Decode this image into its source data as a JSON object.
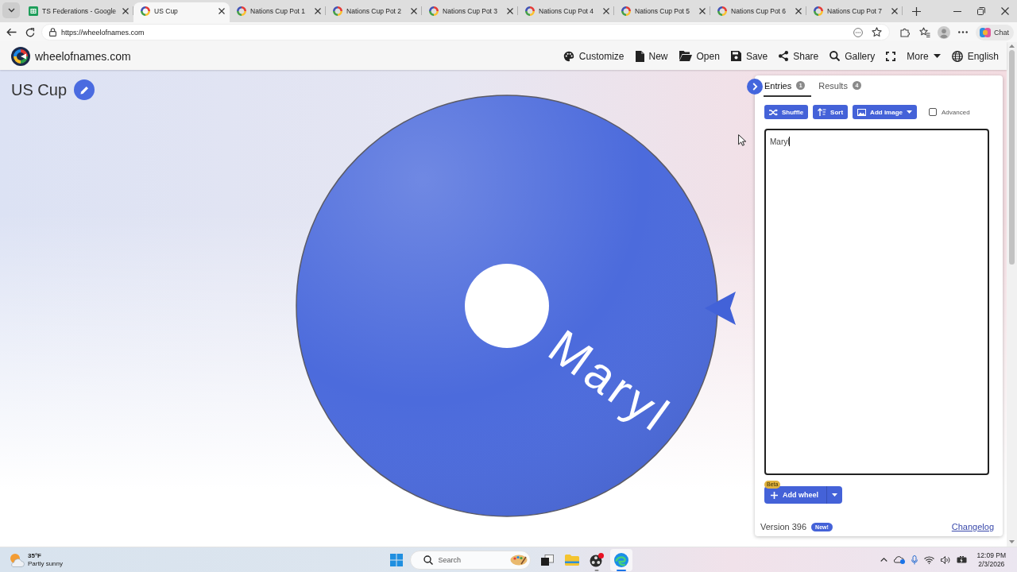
{
  "browser": {
    "tabs": [
      {
        "title": "TS Federations - Google",
        "kind": "sheets",
        "selected": false
      },
      {
        "title": "US Cup",
        "kind": "wheel",
        "selected": true
      },
      {
        "title": "Nations Cup Pot 1",
        "kind": "wheel",
        "selected": false
      },
      {
        "title": "Nations Cup Pot 2",
        "kind": "wheel",
        "selected": false
      },
      {
        "title": "Nations Cup Pot 3",
        "kind": "wheel",
        "selected": false
      },
      {
        "title": "Nations Cup Pot 4",
        "kind": "wheel",
        "selected": false
      },
      {
        "title": "Nations Cup Pot 5",
        "kind": "wheel",
        "selected": false
      },
      {
        "title": "Nations Cup Pot 6",
        "kind": "wheel",
        "selected": false
      },
      {
        "title": "Nations Cup Pot 7",
        "kind": "wheel",
        "selected": false
      }
    ],
    "url": "https://wheelofnames.com",
    "chat": "Chat"
  },
  "site": {
    "name": "wheelofnames.com",
    "nav": [
      {
        "kind": "customize",
        "label": "Customize"
      },
      {
        "kind": "new",
        "label": "New"
      },
      {
        "kind": "open",
        "label": "Open"
      },
      {
        "kind": "save",
        "label": "Save"
      },
      {
        "kind": "share",
        "label": "Share"
      },
      {
        "kind": "gallery",
        "label": "Gallery"
      },
      {
        "kind": "fullscreen"
      },
      {
        "kind": "more",
        "label": "More"
      },
      {
        "kind": "language",
        "label": "English"
      }
    ]
  },
  "wheel": {
    "title": "US Cup",
    "slices": [
      {
        "label": "Maryl"
      }
    ]
  },
  "panel": {
    "tabs": [
      {
        "label": "Entries",
        "count": "1",
        "selected": true
      },
      {
        "label": "Results",
        "count": "4",
        "selected": false
      }
    ],
    "tools": [
      {
        "kind": "shuffle",
        "label": "Shuffle"
      },
      {
        "kind": "sort",
        "label": "Sort"
      },
      {
        "kind": "add_image",
        "label": "Add image"
      }
    ],
    "advanced": {
      "label": "Advanced",
      "checked": false
    },
    "entries": [
      "Maryl"
    ],
    "add_wheel": {
      "label": "Add wheel",
      "badge": "Beta"
    },
    "version": "Version 396",
    "version_badge": "New!",
    "changelog": "Changelog"
  },
  "taskbar": {
    "weather": {
      "temperature": "35°F",
      "condition": "Partly sunny"
    },
    "search_placeholder": "Search",
    "apps": [
      {
        "kind": "task_view",
        "selected": false,
        "running": false
      },
      {
        "kind": "file_explorer",
        "selected": false,
        "running": false
      },
      {
        "kind": "recorder",
        "selected": false,
        "running": true
      },
      {
        "kind": "browser",
        "selected": true,
        "running": true
      }
    ],
    "time": "12:09 PM",
    "date": "2/3/2026"
  }
}
